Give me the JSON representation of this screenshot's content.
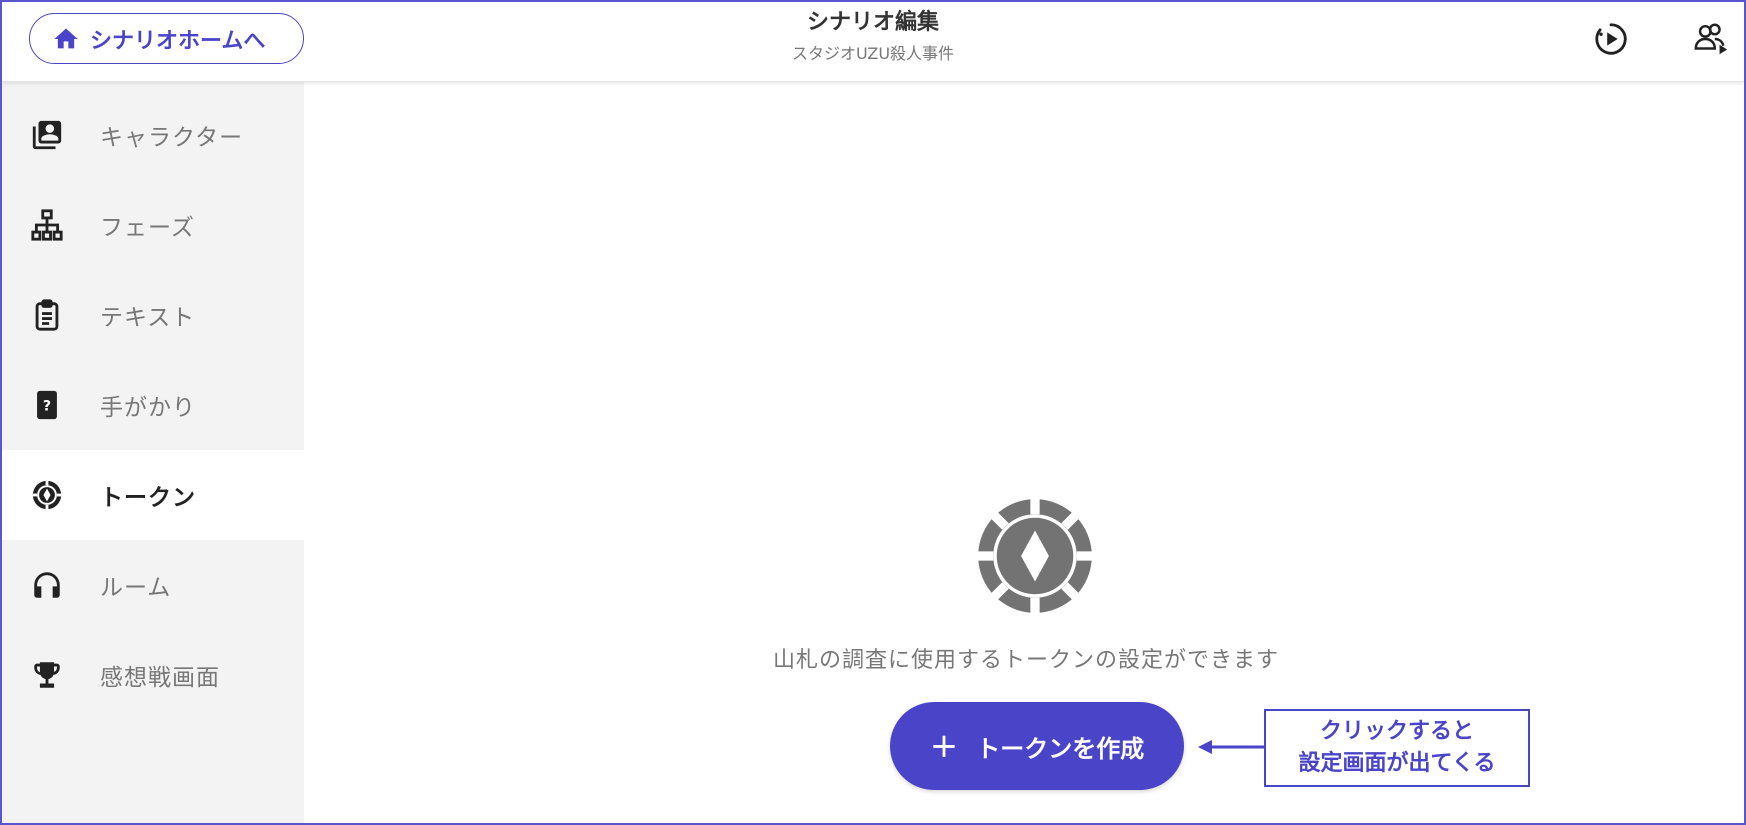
{
  "header": {
    "home_button_label": "シナリオホームへ",
    "title": "シナリオ編集",
    "subtitle": "スタジオUZU殺人事件"
  },
  "icons": {
    "home": "home-icon",
    "play": "play-circle-icon",
    "people": "people-play-icon"
  },
  "sidebar": {
    "items": [
      {
        "label": "キャラクター",
        "icon": "contacts-icon",
        "active": false
      },
      {
        "label": "フェーズ",
        "icon": "sitemap-icon",
        "active": false
      },
      {
        "label": "テキスト",
        "icon": "clipboard-icon",
        "active": false
      },
      {
        "label": "手がかり",
        "icon": "question-card-icon",
        "active": false
      },
      {
        "label": "トークン",
        "icon": "token-chip-icon",
        "active": true
      },
      {
        "label": "ルーム",
        "icon": "headphones-icon",
        "active": false
      },
      {
        "label": "感想戦画面",
        "icon": "trophy-icon",
        "active": false
      }
    ]
  },
  "main": {
    "empty_message": "山札の調査に使用するトークンの設定ができます",
    "create_button_label": "トークンを作成"
  },
  "annotation": {
    "line1": "クリックすると",
    "line2": "設定画面が出てくる"
  },
  "colors": {
    "accent": "#4a45c8",
    "sidebar_bg": "#f3f3f3",
    "icon_gray": "#737373"
  }
}
